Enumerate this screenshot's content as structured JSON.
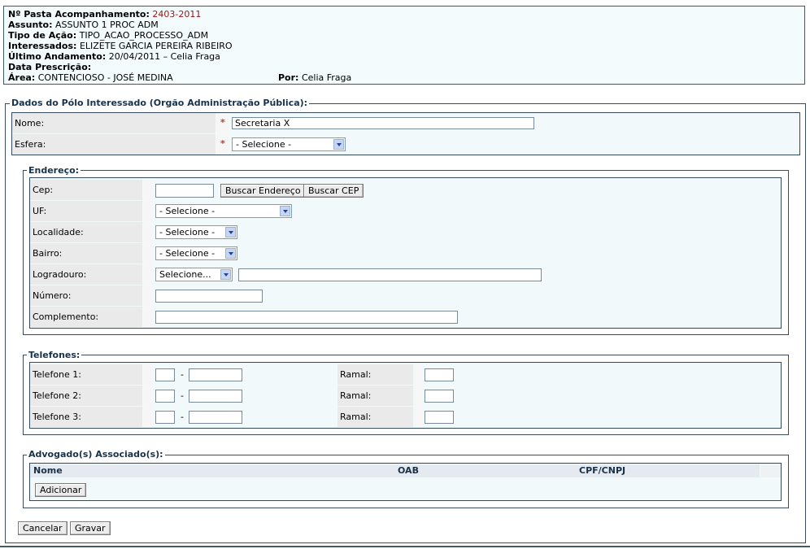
{
  "header": {
    "pasta_label": "Nº Pasta Acompanhamento:",
    "pasta_value": "2403-2011",
    "assunto_label": "Assunto:",
    "assunto_value": "ASSUNTO 1 PROC ADM",
    "tipo_label": "Tipo de Ação:",
    "tipo_value": "TIPO_ACAO_PROCESSO_ADM",
    "interessados_label": "Interessados:",
    "interessados_value": "ELIZETE GARCIA PEREIRA RIBEIRO",
    "ultimo_label": "Último Andamento:",
    "ultimo_value": "20/04/2011 – Celia Fraga",
    "prescricao_label": "Data Prescrição:",
    "area_label": "Área:",
    "area_value": "CONTENCIOSO - JOSÉ MEDINA",
    "por_label": "Por:",
    "por_value": "Celia Fraga"
  },
  "polo": {
    "legend": "Dados do Pólo Interessado (Orgão Administração Pública):",
    "nome_label": "Nome:",
    "nome_value": "Secretaria X",
    "esfera_label": "Esfera:",
    "esfera_value": "- Selecione -",
    "required_mark": "*"
  },
  "endereco": {
    "legend": "Endereço:",
    "cep_label": "Cep:",
    "cep_value": "",
    "buscar_endereco": "Buscar Endereço",
    "buscar_cep": "Buscar CEP",
    "uf_label": "UF:",
    "uf_value": "- Selecione -",
    "localidade_label": "Localidade:",
    "localidade_value": "- Selecione -",
    "bairro_label": "Bairro:",
    "bairro_value": "- Selecione -",
    "logradouro_label": "Logradouro:",
    "logradouro_value": "Selecione...",
    "numero_label": "Número:",
    "complemento_label": "Complemento:"
  },
  "telefones": {
    "legend": "Telefones:",
    "separator": "-",
    "ramal_label": "Ramal:",
    "rows": [
      {
        "label": "Telefone 1:"
      },
      {
        "label": "Telefone 2:"
      },
      {
        "label": "Telefone 3:"
      }
    ]
  },
  "advogados": {
    "legend": "Advogado(s) Associado(s):",
    "columns": [
      "Nome",
      "OAB",
      "CPF/CNPJ"
    ],
    "add_button": "Adicionar"
  },
  "actions": {
    "cancel": "Cancelar",
    "save": "Gravar"
  },
  "icons": {
    "dropdown": "chevron-down-icon"
  }
}
